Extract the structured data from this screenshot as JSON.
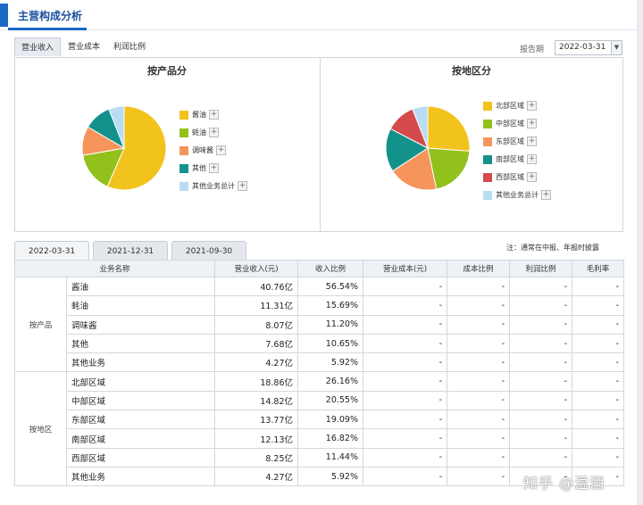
{
  "header": {
    "title": "主营构成分析"
  },
  "subtabs": [
    "营业收入",
    "营业成本",
    "利润比例"
  ],
  "period": {
    "label": "报告期",
    "value": "2022-03-31"
  },
  "charts": {
    "product": {
      "title": "按产品分",
      "legend": [
        "酱油",
        "蚝油",
        "调味酱",
        "其他",
        "其他业务总计"
      ]
    },
    "region": {
      "title": "按地区分",
      "legend": [
        "北部区域",
        "中部区域",
        "东部区域",
        "南部区域",
        "西部区域",
        "其他业务总计"
      ]
    }
  },
  "chart_data": [
    {
      "type": "pie",
      "title": "按产品分",
      "categories": [
        "酱油",
        "蚝油",
        "调味酱",
        "其他",
        "其他业务总计"
      ],
      "values": [
        56.54,
        15.69,
        11.2,
        10.65,
        5.92
      ],
      "colors": [
        "#f2c31d",
        "#92c11c",
        "#f5955b",
        "#13928c",
        "#b9dcf2"
      ]
    },
    {
      "type": "pie",
      "title": "按地区分",
      "categories": [
        "北部区域",
        "中部区域",
        "东部区域",
        "南部区域",
        "西部区域",
        "其他业务总计"
      ],
      "values": [
        26.16,
        20.55,
        19.09,
        16.82,
        11.44,
        5.92
      ],
      "colors": [
        "#f2c31d",
        "#92c11c",
        "#f5955b",
        "#13928c",
        "#d54a4a",
        "#b9dcf2"
      ]
    }
  ],
  "date_tabs": [
    "2022-03-31",
    "2021-12-31",
    "2021-09-30"
  ],
  "note": "注：通常在中报、年报时披露",
  "table": {
    "headers": [
      "业务名称",
      "营业收入(元)",
      "收入比例",
      "营业成本(元)",
      "成本比例",
      "利润比例",
      "毛利率"
    ],
    "groups": [
      {
        "label": "按产品",
        "rows": [
          [
            "酱油",
            "40.76亿",
            "56.54%",
            "-",
            "-",
            "-",
            "-"
          ],
          [
            "蚝油",
            "11.31亿",
            "15.69%",
            "-",
            "-",
            "-",
            "-"
          ],
          [
            "调味酱",
            "8.07亿",
            "11.20%",
            "-",
            "-",
            "-",
            "-"
          ],
          [
            "其他",
            "7.68亿",
            "10.65%",
            "-",
            "-",
            "-",
            "-"
          ],
          [
            "其他业务",
            "4.27亿",
            "5.92%",
            "-",
            "-",
            "-",
            "-"
          ]
        ]
      },
      {
        "label": "按地区",
        "rows": [
          [
            "北部区域",
            "18.86亿",
            "26.16%",
            "-",
            "-",
            "-",
            "-"
          ],
          [
            "中部区域",
            "14.82亿",
            "20.55%",
            "-",
            "-",
            "-",
            "-"
          ],
          [
            "东部区域",
            "13.77亿",
            "19.09%",
            "-",
            "-",
            "-",
            "-"
          ],
          [
            "南部区域",
            "12.13亿",
            "16.82%",
            "-",
            "-",
            "-",
            "-"
          ],
          [
            "西部区域",
            "8.25亿",
            "11.44%",
            "-",
            "-",
            "-",
            "-"
          ],
          [
            "其他业务",
            "4.27亿",
            "5.92%",
            "-",
            "-",
            "-",
            "-"
          ]
        ]
      }
    ]
  },
  "watermark": "知乎 @温酒"
}
